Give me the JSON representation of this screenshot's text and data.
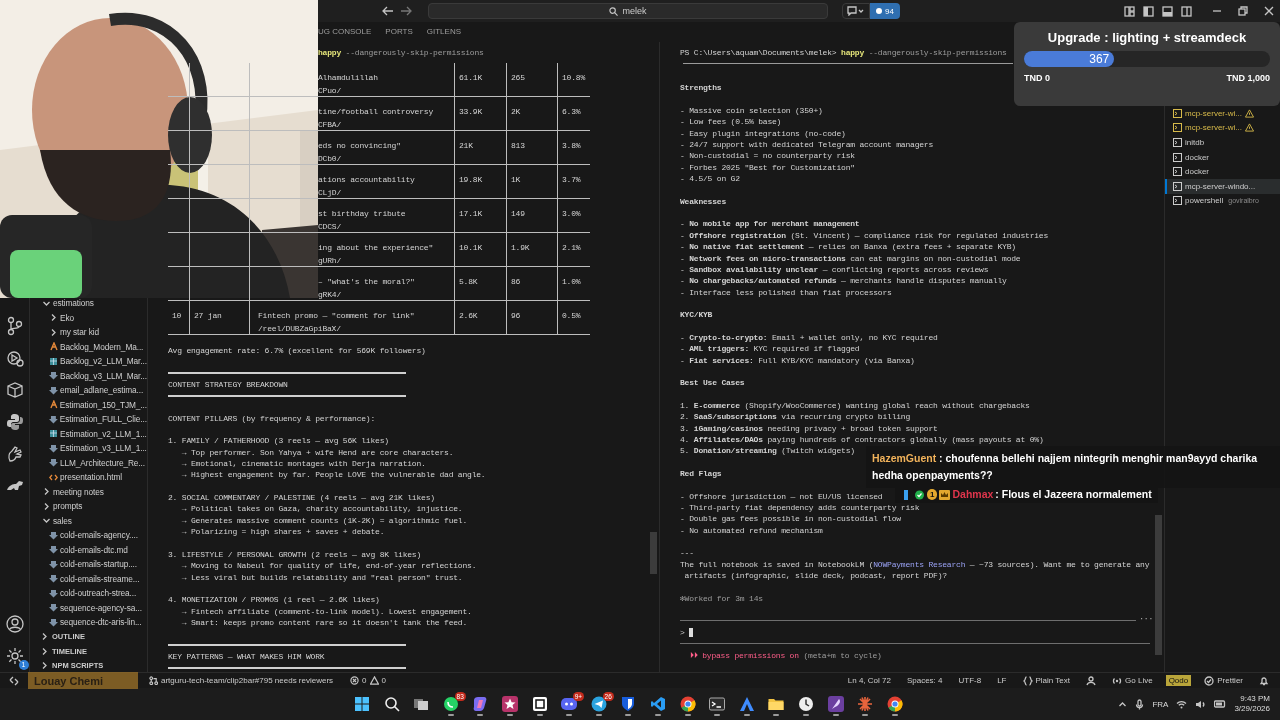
{
  "title_bar": {
    "command_center": "melek",
    "badge": "94"
  },
  "panel_tabs": [
    {
      "label": "UG CONSOLE",
      "selected": false
    },
    {
      "label": "PORTS",
      "selected": false
    },
    {
      "label": "GITLENS",
      "selected": false
    }
  ],
  "activity_bar": {
    "top": [
      {
        "kind": "branch"
      },
      {
        "kind": "run"
      },
      {
        "kind": "box"
      },
      {
        "kind": "python"
      },
      {
        "kind": "hand"
      },
      {
        "kind": "dino"
      }
    ],
    "bottom": [
      {
        "kind": "account"
      },
      {
        "kind": "settings",
        "badge": "1"
      }
    ]
  },
  "explorer": {
    "tree": [
      {
        "label": "estimations",
        "kind": "folder",
        "expanded": true,
        "children": [
          {
            "label": "Eko",
            "kind": "folder",
            "expanded": false
          },
          {
            "label": "my star kid",
            "kind": "folder",
            "expanded": false
          },
          {
            "label": "Backlog_Modern_Ma...",
            "kind": "pdf"
          },
          {
            "label": "Backlog_v2_LLM_Mar...",
            "kind": "sheet"
          },
          {
            "label": "Backlog_v3_LLM_Mar...",
            "kind": "markdown"
          },
          {
            "label": "email_adlane_estima...",
            "kind": "markdown"
          },
          {
            "label": "Estimation_150_TJM_...",
            "kind": "pdf"
          },
          {
            "label": "Estimation_FULL_Clie...",
            "kind": "markdown"
          },
          {
            "label": "Estimation_v2_LLM_1...",
            "kind": "sheet"
          },
          {
            "label": "Estimation_v3_LLM_1...",
            "kind": "markdown"
          },
          {
            "label": "LLM_Architecture_Re...",
            "kind": "markdown"
          },
          {
            "label": "presentation.html",
            "kind": "html"
          }
        ]
      },
      {
        "label": "meeting notes",
        "kind": "folder",
        "expanded": false
      },
      {
        "label": "prompts",
        "kind": "folder",
        "expanded": false
      },
      {
        "label": "sales",
        "kind": "folder",
        "expanded": true,
        "children": [
          {
            "label": "cold-emails-agency....",
            "kind": "markdown"
          },
          {
            "label": "cold-emails-dtc.md",
            "kind": "markdown"
          },
          {
            "label": "cold-emails-startup....",
            "kind": "markdown"
          },
          {
            "label": "cold-emails-streame...",
            "kind": "markdown"
          },
          {
            "label": "cold-outreach-strea...",
            "kind": "markdown"
          },
          {
            "label": "sequence-agency-sa...",
            "kind": "markdown"
          },
          {
            "label": "sequence-dtc-aris-lin...",
            "kind": "markdown"
          }
        ]
      }
    ],
    "sections": [
      {
        "label": "OUTLINE",
        "expanded": false
      },
      {
        "label": "TIMELINE",
        "expanded": false
      },
      {
        "label": "NPM SCRIPTS",
        "expanded": false
      }
    ]
  },
  "left_terminal": {
    "command": "happy",
    "args": "--dangerously-skip-permissions",
    "rows": [
      {
        "title": "Alhamdulillah",
        "path": "CPuo/",
        "views": "61.1K",
        "comments": "265",
        "rate": "10.8%"
      },
      {
        "title": "tine/football controversy",
        "path": "CFBA/",
        "views": "33.9K",
        "comments": "2K",
        "rate": "6.3%"
      },
      {
        "title": "eds no convincing\"",
        "path": "DCb0/",
        "views": "21K",
        "comments": "813",
        "rate": "3.8%"
      },
      {
        "title": "ations accountability",
        "path": "CLjD/",
        "views": "19.8K",
        "comments": "1K",
        "rate": "3.7%"
      },
      {
        "title": "st birthday tribute",
        "path": "CDCS/",
        "views": "17.1K",
        "comments": "149",
        "rate": "3.0%"
      },
      {
        "title": "ing about the experience\"",
        "path": "gURh/",
        "views": "10.1K",
        "comments": "1.9K",
        "rate": "2.1%"
      },
      {
        "title": "– \"what's the moral?\"",
        "path": "gRK4/",
        "views": "5.8K",
        "comments": "86",
        "rate": "1.0%"
      },
      {
        "number": "10",
        "date": "27 jan",
        "title": "Fintech promo — \"comment for link\"",
        "path": "/reel/DUBZaGpiBaX/",
        "views": "2.6K",
        "comments": "96",
        "rate": "0.5%"
      }
    ],
    "lines": [
      {
        "kind": "text",
        "text": "Avg engagement rate: 6.7% (excellent for 569K followers)"
      },
      {
        "kind": "blank"
      },
      {
        "kind": "rule"
      },
      {
        "kind": "text",
        "text": "CONTENT STRATEGY BREAKDOWN"
      },
      {
        "kind": "rule"
      },
      {
        "kind": "blank"
      },
      {
        "kind": "text",
        "text": "CONTENT PILLARS (by frequency & performance):"
      },
      {
        "kind": "blank"
      },
      {
        "kind": "text",
        "text": "1. FAMILY / FATHERHOOD (3 reels — avg 56K likes)"
      },
      {
        "kind": "text",
        "text": "   → Top performer. Son Yahya + wife Hend are core characters."
      },
      {
        "kind": "text",
        "text": "   → Emotional, cinematic montages with Derja narration."
      },
      {
        "kind": "text",
        "text": "   → Highest engagement by far. People LOVE the vulnerable dad angle."
      },
      {
        "kind": "blank"
      },
      {
        "kind": "text",
        "text": "2. SOCIAL COMMENTARY / PALESTINE (4 reels — avg 21K likes)"
      },
      {
        "kind": "text",
        "text": "   → Political takes on Gaza, charity accountability, injustice."
      },
      {
        "kind": "text",
        "text": "   → Generates massive comment counts (1K-2K) = algorithmic fuel."
      },
      {
        "kind": "text",
        "text": "   → Polarizing = high shares + saves + debate."
      },
      {
        "kind": "blank"
      },
      {
        "kind": "text",
        "text": "3. LIFESTYLE / PERSONAL GROWTH (2 reels — avg 8K likes)"
      },
      {
        "kind": "text",
        "text": "   → Moving to Nabeul for quality of life, end-of-year reflections."
      },
      {
        "kind": "text",
        "text": "   → Less viral but builds relatability and \"real person\" trust."
      },
      {
        "kind": "blank"
      },
      {
        "kind": "text",
        "text": "4. MONETIZATION / PROMOS (1 reel — 2.6K likes)"
      },
      {
        "kind": "text",
        "text": "   → Fintech affiliate (comment-to-link model). Lowest engagement."
      },
      {
        "kind": "text",
        "text": "   → Smart: keeps promo content rare so it doesn't tank the feed."
      },
      {
        "kind": "blank"
      },
      {
        "kind": "rule"
      },
      {
        "kind": "text",
        "text": "KEY PATTERNS — WHAT MAKES HIM WORK"
      },
      {
        "kind": "rule"
      }
    ]
  },
  "right_terminal": {
    "prompt": "PS C:\\Users\\aquam\\Documents\\melek>",
    "command": "happy",
    "args": "--dangerously-skip-permissions",
    "lines": [
      {
        "kind": "heading",
        "text": "Strengths"
      },
      {
        "kind": "blank"
      },
      {
        "kind": "text",
        "text": "- Massive coin selection (350+)"
      },
      {
        "kind": "text",
        "text": "- Low fees (0.5% base)"
      },
      {
        "kind": "text",
        "text": "- Easy plugin integrations (no-code)"
      },
      {
        "kind": "text",
        "text": "- 24/7 support with dedicated Telegram account managers"
      },
      {
        "kind": "text",
        "text": "- Non-custodial = no counterparty risk"
      },
      {
        "kind": "text",
        "text": "- Forbes 2025 \"Best for Customization\""
      },
      {
        "kind": "text",
        "text": "- 4.5/5 on G2"
      },
      {
        "kind": "blank"
      },
      {
        "kind": "heading",
        "text": "Weaknesses"
      },
      {
        "kind": "blank"
      },
      {
        "kind": "text",
        "text": "- **No mobile app for merchant management**"
      },
      {
        "kind": "text",
        "text": "- **Offshore registration** (St. Vincent) — compliance risk for regulated industries"
      },
      {
        "kind": "text",
        "text": "- **No native fiat settlement** — relies on Banxa (extra fees + separate KYB)"
      },
      {
        "kind": "text",
        "text": "- **Network fees on micro-transactions** can eat margins on non-custodial mode"
      },
      {
        "kind": "text",
        "text": "- **Sandbox availability unclear** — conflicting reports across reviews"
      },
      {
        "kind": "text",
        "text": "- **No chargebacks/automated refunds** — merchants handle disputes manually"
      },
      {
        "kind": "text",
        "text": "- Interface less polished than fiat processors"
      },
      {
        "kind": "blank"
      },
      {
        "kind": "heading",
        "text": "KYC/KYB"
      },
      {
        "kind": "blank"
      },
      {
        "kind": "text",
        "text": "- **Crypto-to-crypto:** Email + wallet only, no KYC required"
      },
      {
        "kind": "text",
        "text": "- **AML triggers:** KYC required if flagged"
      },
      {
        "kind": "text",
        "text": "- **Fiat services:** Full KYB/KYC mandatory (via Banxa)"
      },
      {
        "kind": "blank"
      },
      {
        "kind": "heading",
        "text": "Best Use Cases"
      },
      {
        "kind": "blank"
      },
      {
        "kind": "text",
        "text": "1. **E-commerce** (Shopify/WooCommerce) wanting global reach without chargebacks"
      },
      {
        "kind": "text",
        "text": "2. **SaaS/subscriptions** via recurring crypto billing"
      },
      {
        "kind": "text",
        "text": "3. **iGaming/casinos** needing privacy + broad token support"
      },
      {
        "kind": "text",
        "text": "4. **Affiliates/DAOs** paying hundreds of contractors globally (mass payouts at 0%)"
      },
      {
        "kind": "text",
        "text": "5. **Donation/streaming** (Twitch widgets)"
      },
      {
        "kind": "blank"
      },
      {
        "kind": "heading",
        "text": "Red Flags"
      },
      {
        "kind": "blank"
      },
      {
        "kind": "text",
        "text": "- Offshore jurisdiction — not EU/US licensed"
      },
      {
        "kind": "text",
        "text": "- Third-party fiat dependency adds counterparty risk"
      },
      {
        "kind": "text",
        "text": "- Double gas fees possible in non-custodial flow"
      },
      {
        "kind": "text",
        "text": "- No automated refund mechanism"
      },
      {
        "kind": "blank"
      },
      {
        "kind": "text",
        "text": "---"
      },
      {
        "kind": "note",
        "before": "The full notebook is saved in NotebookLM (",
        "link": "NOWPayments Research",
        "after": " — ~73 sources). Want me to generate any\n artifacts (infographic, slide deck, podcast, report PDF)?"
      },
      {
        "kind": "blank"
      },
      {
        "kind": "status",
        "text": "✻Worked for 3m 14s"
      }
    ],
    "more": "···",
    "input_prompt": ">",
    "mode": "⏵⏵ bypass permissions on",
    "mode_hint": "(meta+m to cycle)"
  },
  "terminal_list": [
    {
      "label": "mcp-server-wi...",
      "warning": true,
      "selected": false
    },
    {
      "label": "mcp-server-wi...",
      "warning": true,
      "selected": false
    },
    {
      "label": "initdb",
      "warning": false,
      "selected": false
    },
    {
      "label": "docker",
      "warning": false,
      "selected": false
    },
    {
      "label": "docker",
      "warning": false,
      "selected": false
    },
    {
      "label": "mcp-server-windo...",
      "warning": false,
      "selected": true
    },
    {
      "label": "powershell",
      "detail": "goviralbro",
      "warning": false,
      "selected": false
    }
  ],
  "upgrade_widget": {
    "title": "Upgrade : lighting + streamdeck",
    "value": "367",
    "level": 0.367,
    "min_label": "TND 0",
    "max_label": "TND 1,000"
  },
  "chat": [
    {
      "user": "HazemGuent",
      "color": "#f2b35b",
      "message": " : choufenna bellehi najjem nintegrih menghir man9ayyd charika hedha openpayments??"
    },
    {
      "user": "Dahmax",
      "color": "#e0354c",
      "message": " : Flous el Jazeera normalement",
      "badges": [
        {
          "kind": "bar"
        },
        {
          "kind": "check"
        },
        {
          "kind": "coin",
          "text": "1"
        },
        {
          "kind": "crown"
        }
      ]
    }
  ],
  "stream_label": "Louay Chemi",
  "status_bar": {
    "branch": "artguru-tech-team/clip2bar#795 needs reviewers",
    "errors": "0",
    "warnings": "0",
    "right": [
      {
        "kind": "text",
        "text": "Ln 4, Col 72",
        "highlighted": false
      },
      {
        "kind": "text",
        "text": "Spaces: 4",
        "highlighted": false
      },
      {
        "kind": "text",
        "text": "UTF-8",
        "highlighted": false
      },
      {
        "kind": "text",
        "text": "LF",
        "highlighted": false
      },
      {
        "kind": "braces",
        "text": "Plain Text",
        "highlighted": false
      },
      {
        "kind": "person",
        "highlighted": false
      },
      {
        "kind": "radio",
        "text": "Go Live",
        "highlighted": false
      },
      {
        "kind": "text",
        "text": "Qodo",
        "highlighted": true
      },
      {
        "kind": "check",
        "text": "Prettier",
        "highlighted": false
      },
      {
        "kind": "bell",
        "highlighted": false
      }
    ]
  },
  "taskbar": {
    "apps": [
      {
        "kind": "windows",
        "running": false
      },
      {
        "kind": "search",
        "running": false
      },
      {
        "kind": "taskview",
        "running": false
      },
      {
        "kind": "chat",
        "running": true,
        "badge": "83"
      },
      {
        "kind": "sparkle",
        "running": true
      },
      {
        "kind": "star",
        "running": true
      },
      {
        "kind": "notebook",
        "running": true
      },
      {
        "kind": "gamepad",
        "running": true,
        "badge": "9+"
      },
      {
        "kind": "plane",
        "running": true,
        "badge": "26"
      },
      {
        "kind": "shield",
        "running": true
      },
      {
        "kind": "code",
        "running": true
      },
      {
        "kind": "browser",
        "running": true
      },
      {
        "kind": "terminal",
        "running": true
      },
      {
        "kind": "triangle",
        "running": true
      },
      {
        "kind": "folder",
        "running": true
      },
      {
        "kind": "clock",
        "running": true
      },
      {
        "kind": "feather",
        "running": true
      },
      {
        "kind": "burst",
        "running": true
      },
      {
        "kind": "browser",
        "running": true
      }
    ],
    "language": "FRA",
    "time": "9:43 PM",
    "date": "3/29/2026"
  }
}
